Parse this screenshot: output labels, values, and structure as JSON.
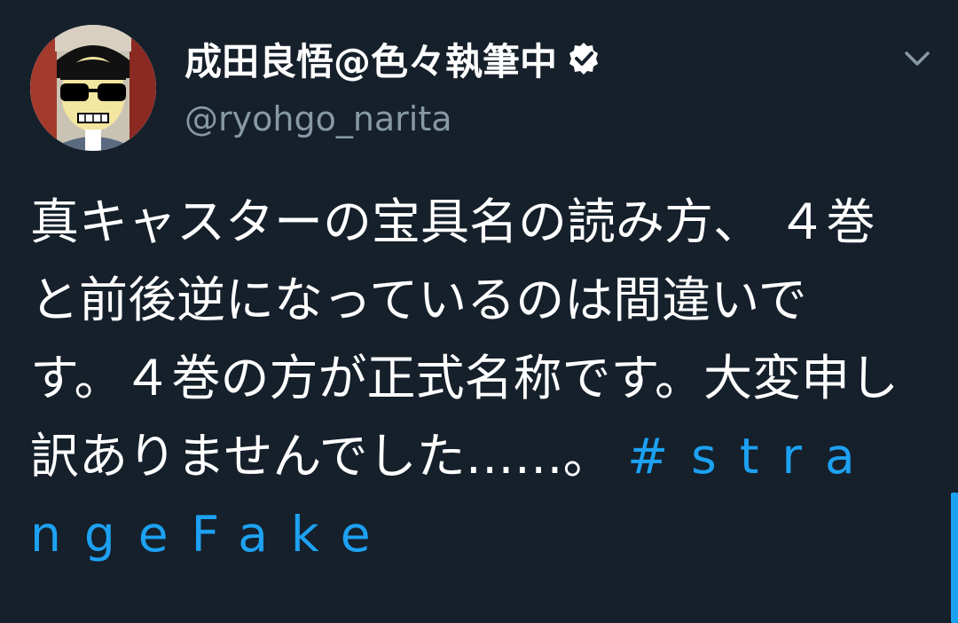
{
  "tweet": {
    "display_name": "成田良悟@色々執筆中",
    "handle": "@ryohgo_narita",
    "text": "真キャスターの宝具名の読み方、 ４巻と前後逆になっているのは間違いです。４巻の方が正式名称です。大変申し訳ありませんでした……。 ",
    "hashtag": "#strangeFake",
    "verified": true
  },
  "icons": {
    "verified": "verified-badge-icon",
    "menu": "chevron-down-icon",
    "avatar": "avatar"
  },
  "colors": {
    "background": "#15202b",
    "text": "#ffffff",
    "secondary": "#8899a6",
    "accent": "#1da1f2"
  }
}
